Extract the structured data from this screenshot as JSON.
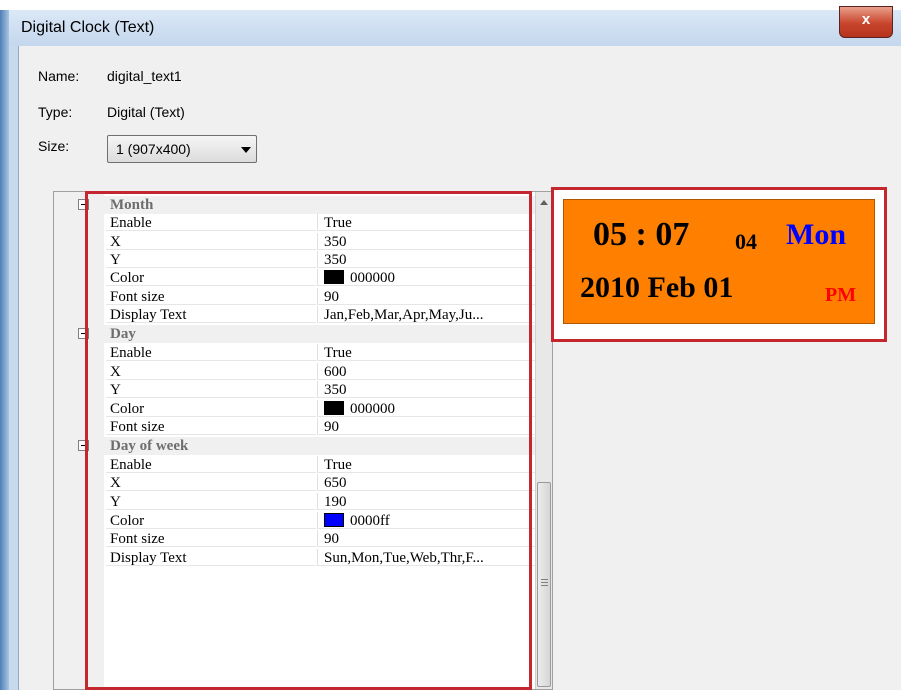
{
  "window": {
    "title": "Digital Clock (Text)",
    "close_label": "x"
  },
  "info": {
    "name_label": "Name:",
    "name_value": "digital_text1",
    "type_label": "Type:",
    "type_value": "Digital (Text)",
    "size_label": "Size:",
    "size_value": "1  (907x400)"
  },
  "grid": {
    "categories": [
      "Month",
      "Day",
      "Day of week"
    ],
    "props": [
      {
        "name": "Enable",
        "value": "True"
      },
      {
        "name": "X",
        "value": "350"
      },
      {
        "name": "Y",
        "value": "350"
      },
      {
        "name": "Color",
        "value": "000000",
        "swatch": "#000000"
      },
      {
        "name": "Font size",
        "value": "90"
      },
      {
        "name": "Display Text",
        "value": "Jan,Feb,Mar,Apr,May,Ju..."
      },
      {
        "name": "Enable",
        "value": "True"
      },
      {
        "name": "X",
        "value": "600"
      },
      {
        "name": "Y",
        "value": "350"
      },
      {
        "name": "Color",
        "value": "000000",
        "swatch": "#000000"
      },
      {
        "name": "Font size",
        "value": "90"
      },
      {
        "name": "Enable",
        "value": "True"
      },
      {
        "name": "X",
        "value": "650"
      },
      {
        "name": "Y",
        "value": "190"
      },
      {
        "name": "Color",
        "value": "0000ff",
        "swatch": "#0000ff"
      },
      {
        "name": "Font size",
        "value": "90"
      },
      {
        "name": "Display Text",
        "value": "Sun,Mon,Tue,Web,Thr,F..."
      }
    ]
  },
  "preview": {
    "time": "05 : 07",
    "seconds": "04",
    "day_of_week": "Mon",
    "date": "2010 Feb 01",
    "ampm": "PM",
    "background": "#ff8000",
    "dow_color": "#0000ff",
    "ampm_color": "#ff0000"
  },
  "colors": {
    "highlight": "#c4272e"
  }
}
